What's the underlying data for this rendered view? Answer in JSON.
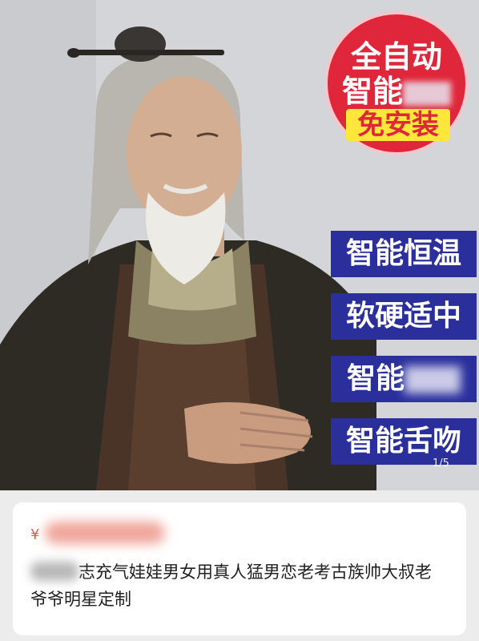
{
  "product_image": {
    "badge": {
      "line1": "全自动",
      "line2": "智能抽插",
      "line2_visible": "智能",
      "line3": "免安装"
    },
    "features": [
      {
        "label": "智能恒温"
      },
      {
        "label": "软硬适中"
      },
      {
        "label": "智能",
        "blurred_suffix": true
      },
      {
        "label": "智能舌吻"
      }
    ],
    "indicator": "1/5"
  },
  "info": {
    "currency": "¥",
    "title": "志充气娃娃男女用真人猛男恋老考古族帅大叔老爷爷明星定制"
  },
  "colors": {
    "badge_red": "#e0263a",
    "badge_yellow": "#ffe63a",
    "feature_blue": "#2a2f9c",
    "price_red": "#e8584a"
  }
}
